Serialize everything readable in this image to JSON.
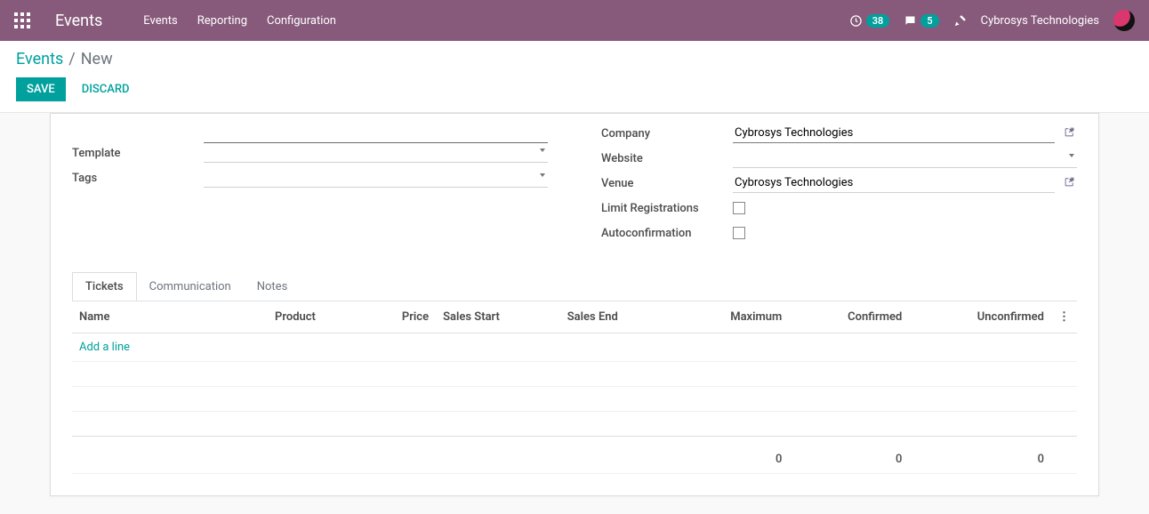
{
  "topbar": {
    "app_title": "Events",
    "menu": {
      "events": "Events",
      "reporting": "Reporting",
      "configuration": "Configuration"
    },
    "badges": {
      "activities": "38",
      "discuss": "5"
    },
    "user_name": "Cybrosys Technologies"
  },
  "breadcrumb": {
    "root": "Events",
    "sep": "/",
    "current": "New"
  },
  "controls": {
    "save": "SAVE",
    "discard": "DISCARD"
  },
  "form": {
    "left": {
      "template_label": "Template",
      "template_value": "",
      "tags_label": "Tags",
      "tags_value": ""
    },
    "right": {
      "company_label": "Company",
      "company_value": "Cybrosys Technologies",
      "website_label": "Website",
      "website_value": "",
      "venue_label": "Venue",
      "venue_value": "Cybrosys Technologies",
      "limit_label": "Limit Registrations",
      "autoconf_label": "Autoconfirmation"
    }
  },
  "notebook": {
    "tabs": {
      "tickets": "Tickets",
      "communication": "Communication",
      "notes": "Notes"
    }
  },
  "tickets": {
    "headers": {
      "name": "Name",
      "product": "Product",
      "price": "Price",
      "sales_start": "Sales Start",
      "sales_end": "Sales End",
      "maximum": "Maximum",
      "confirmed": "Confirmed",
      "unconfirmed": "Unconfirmed"
    },
    "add_line": "Add a line",
    "totals": {
      "maximum": "0",
      "confirmed": "0",
      "unconfirmed": "0"
    },
    "optional_glyph": "⋮"
  }
}
